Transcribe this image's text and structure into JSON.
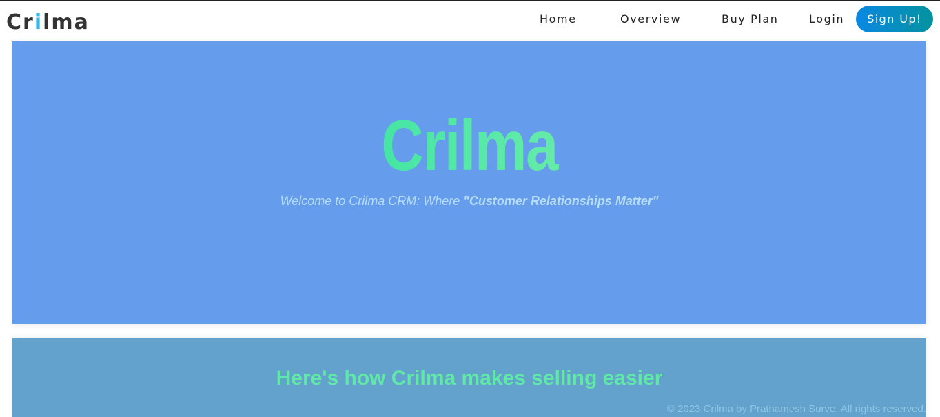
{
  "header": {
    "logo": {
      "part1": "Cr",
      "accent": "i",
      "part2": "lma"
    },
    "nav": {
      "home": "Home",
      "overview": "Overview",
      "buy_plan": "Buy Plan",
      "login": "Login"
    },
    "signup_label": "Sign Up!"
  },
  "hero": {
    "title": "Crilma",
    "subtitle_prefix": "Welcome to Crilma CRM: Where ",
    "subtitle_emphasis": "\"Customer Relationships Matter\""
  },
  "features": {
    "heading": "Here's how Crilma makes selling easier"
  },
  "footer": {
    "copyright": "© 2023 Crilma by Prathamesh Surve. All rights reserved."
  },
  "colors": {
    "hero_background": "#659ceb",
    "features_background": "#63a2cc",
    "signup_gradient_start": "#0a88e3",
    "signup_gradient_end": "#03939e",
    "title_gradient_start": "#10dc9c",
    "title_gradient_end": "#8cf5a6",
    "logo_accent": "#38b6e6"
  }
}
